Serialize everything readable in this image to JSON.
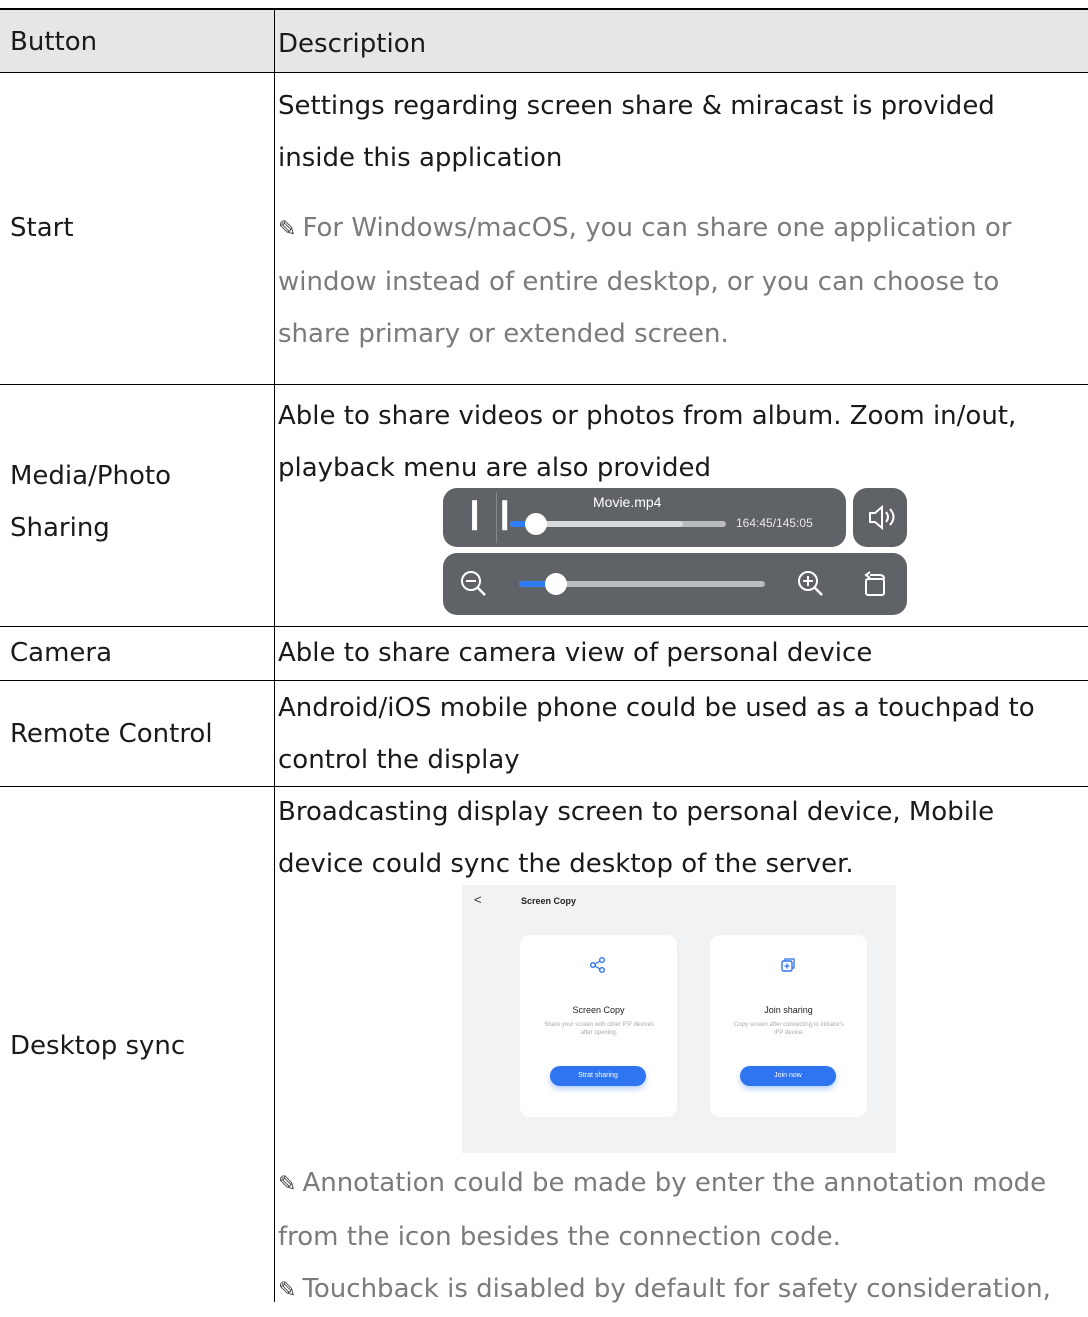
{
  "header": {
    "col1": "Button",
    "col2": "Description"
  },
  "rows": {
    "start": {
      "label": "Start",
      "desc_line1": "Settings regarding screen share & miracast is provided",
      "desc_line2": "inside this application",
      "note_line1": "For Windows/macOS, you can share one application or",
      "note_line2": "window instead of entire desktop, or you can choose to",
      "note_line3": "share primary or extended screen."
    },
    "media": {
      "label_line1": "Media/Photo",
      "label_line2": "Sharing",
      "desc_line1": "Able to share videos or photos from album. Zoom in/out,",
      "desc_line2": "playback menu are also provided",
      "player": {
        "title": "Movie.mp4",
        "time": "164:45/145:05",
        "progress": 0.12,
        "buffered": 0.8,
        "zoom": 0.15
      }
    },
    "camera": {
      "label": "Camera",
      "desc": "Able to share camera view of personal device"
    },
    "remote": {
      "label": "Remote Control",
      "desc_line1": "Android/iOS mobile phone could be used as a touchpad to",
      "desc_line2": "control the display"
    },
    "desktop": {
      "label": "Desktop sync",
      "desc_line1": "Broadcasting display screen to personal device, Mobile",
      "desc_line2": "device could sync the desktop of the server.",
      "mock": {
        "back": "<",
        "title": "Screen Copy",
        "card1": {
          "title": "Screen Copy",
          "sub": "Share your screen with other IFP devices after opening.",
          "button": "Strat sharing"
        },
        "card2": {
          "title": "Join sharing",
          "sub": "Copy screen after connecting to initiator's IFP device.",
          "button": "Join now"
        }
      },
      "note1_line1": "Annotation could be made by enter the annotation mode",
      "note1_line2": "from the icon besides the connection code.",
      "note2_line1": "Touchback is disabled by default for safety consideration,"
    }
  },
  "icons": {
    "note": "pencil-icon",
    "pause": "pause-icon",
    "volume": "volume-icon",
    "zoom_out": "zoom-out-icon",
    "zoom_in": "zoom-in-icon",
    "rotate": "rotate-icon",
    "share": "share-icon",
    "join": "join-icon"
  },
  "colors": {
    "header_bg": "#e7e6e6",
    "note_text": "#7b7b7b",
    "control_bg": "#5f6266",
    "accent": "#2f7bf6"
  }
}
